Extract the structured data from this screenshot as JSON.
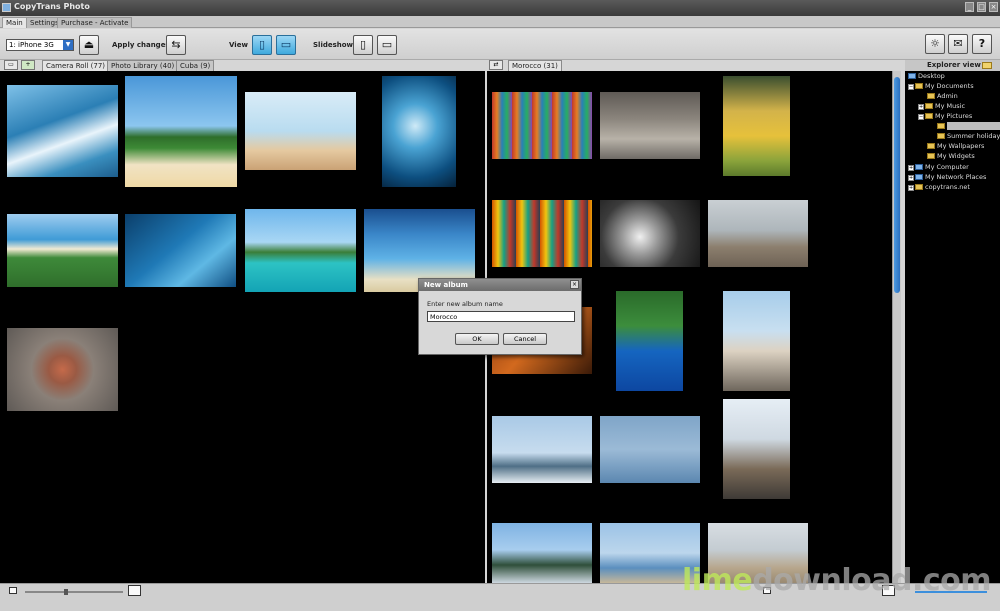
{
  "window": {
    "title": "CopyTrans Photo"
  },
  "menu_tabs": [
    "Main",
    "Settings",
    "Purchase - Activate"
  ],
  "toolbar": {
    "device": "1: iPhone 3G",
    "eject_icon": "eject-icon",
    "apply_changes_label": "Apply changes",
    "view_label": "View",
    "slideshow_label": "Slideshow",
    "help_icons": [
      "lightbulb-icon",
      "mail-icon",
      "help-icon"
    ]
  },
  "left_tabs": [
    "Camera Roll (77)",
    "Photo Library (40)",
    "Cuba (9)"
  ],
  "right_tabs": [
    "Morocco (31)"
  ],
  "explorer": {
    "title": "Explorer view",
    "tree": [
      {
        "label": "Desktop",
        "level": 0
      },
      {
        "label": "My Documents",
        "level": 1
      },
      {
        "label": "Admin",
        "level": 2
      },
      {
        "label": "My Music",
        "level": 2
      },
      {
        "label": "My Pictures",
        "level": 2
      },
      {
        "label": "Summer holiday",
        "level": 3
      },
      {
        "label": "Summer holiday",
        "level": 3
      },
      {
        "label": "My Wallpapers",
        "level": 2
      },
      {
        "label": "My Widgets",
        "level": 2
      },
      {
        "label": "My Computer",
        "level": 1
      },
      {
        "label": "My Network Places",
        "level": 1
      },
      {
        "label": "copytrans.net",
        "level": 1
      }
    ]
  },
  "dialog": {
    "title": "New album",
    "prompt": "Enter new album name",
    "value": "Morocco",
    "ok_label": "OK",
    "cancel_label": "Cancel"
  },
  "watermark": {
    "part1": "lime",
    "part2": "download.com"
  },
  "colors": {
    "accent": "#3ea9dd",
    "pane_bg": "#000000",
    "chrome": "#d6d6d6"
  }
}
